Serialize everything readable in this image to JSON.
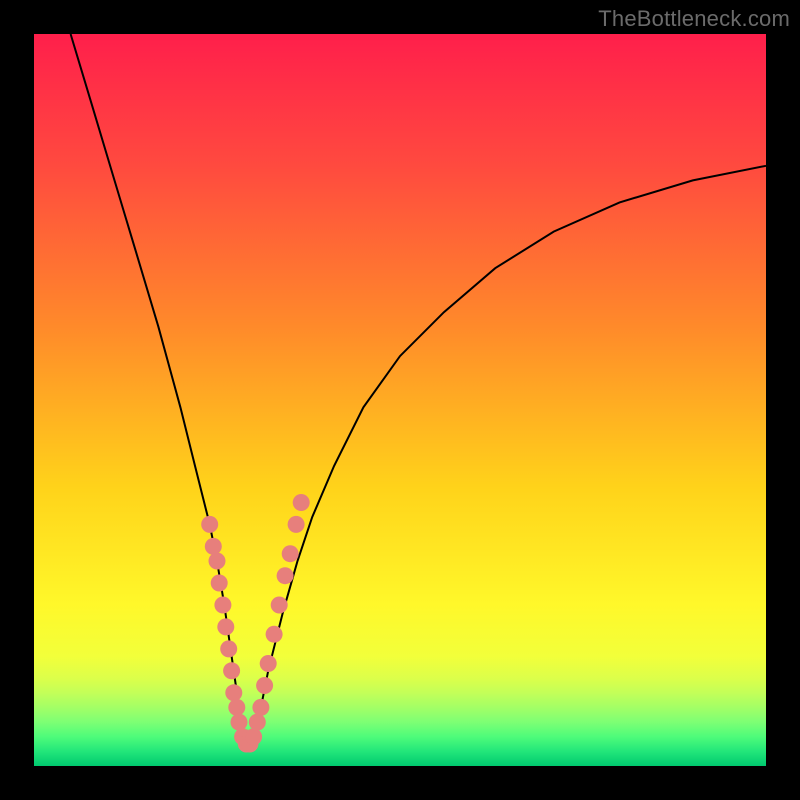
{
  "watermark": "TheBottleneck.com",
  "colors": {
    "frame": "#000000",
    "dot": "#e77f7c",
    "curve": "#000000"
  },
  "chart_data": {
    "type": "line",
    "title": "",
    "xlabel": "",
    "ylabel": "",
    "xlim": [
      0,
      100
    ],
    "ylim": [
      0,
      100
    ],
    "grid": false,
    "legend": false,
    "notch_x": 29,
    "series": [
      {
        "name": "bottleneck-curve",
        "x": [
          5,
          8,
          11,
          14,
          17,
          20,
          22,
          24,
          25,
          26,
          27,
          28,
          29,
          30,
          31,
          32,
          34,
          36,
          38,
          41,
          45,
          50,
          56,
          63,
          71,
          80,
          90,
          100
        ],
        "y": [
          100,
          90,
          80,
          70,
          60,
          49,
          41,
          33,
          28,
          22,
          15,
          8,
          3,
          4,
          8,
          13,
          21,
          28,
          34,
          41,
          49,
          56,
          62,
          68,
          73,
          77,
          80,
          82
        ]
      }
    ],
    "points": [
      {
        "x": 24.0,
        "y": 33
      },
      {
        "x": 24.5,
        "y": 30
      },
      {
        "x": 25.0,
        "y": 28
      },
      {
        "x": 25.3,
        "y": 25
      },
      {
        "x": 25.8,
        "y": 22
      },
      {
        "x": 26.2,
        "y": 19
      },
      {
        "x": 26.6,
        "y": 16
      },
      {
        "x": 27.0,
        "y": 13
      },
      {
        "x": 27.3,
        "y": 10
      },
      {
        "x": 27.7,
        "y": 8
      },
      {
        "x": 28.0,
        "y": 6
      },
      {
        "x": 28.5,
        "y": 4
      },
      {
        "x": 29.0,
        "y": 3
      },
      {
        "x": 29.5,
        "y": 3
      },
      {
        "x": 30.0,
        "y": 4
      },
      {
        "x": 30.5,
        "y": 6
      },
      {
        "x": 31.0,
        "y": 8
      },
      {
        "x": 31.5,
        "y": 11
      },
      {
        "x": 32.0,
        "y": 14
      },
      {
        "x": 32.8,
        "y": 18
      },
      {
        "x": 33.5,
        "y": 22
      },
      {
        "x": 34.3,
        "y": 26
      },
      {
        "x": 35.0,
        "y": 29
      },
      {
        "x": 35.8,
        "y": 33
      },
      {
        "x": 36.5,
        "y": 36
      }
    ],
    "gradient_stops": [
      {
        "pct": 0,
        "color": "#ff1f4b"
      },
      {
        "pct": 18,
        "color": "#ff4a3f"
      },
      {
        "pct": 40,
        "color": "#ff8a2a"
      },
      {
        "pct": 62,
        "color": "#ffd31a"
      },
      {
        "pct": 78,
        "color": "#fff82a"
      },
      {
        "pct": 85,
        "color": "#f2ff3a"
      },
      {
        "pct": 88,
        "color": "#dcff4a"
      },
      {
        "pct": 90,
        "color": "#c3ff58"
      },
      {
        "pct": 92,
        "color": "#a3ff66"
      },
      {
        "pct": 94,
        "color": "#7dff74"
      },
      {
        "pct": 96,
        "color": "#4efc7a"
      },
      {
        "pct": 98,
        "color": "#22e67a"
      },
      {
        "pct": 100,
        "color": "#00c96f"
      }
    ]
  }
}
